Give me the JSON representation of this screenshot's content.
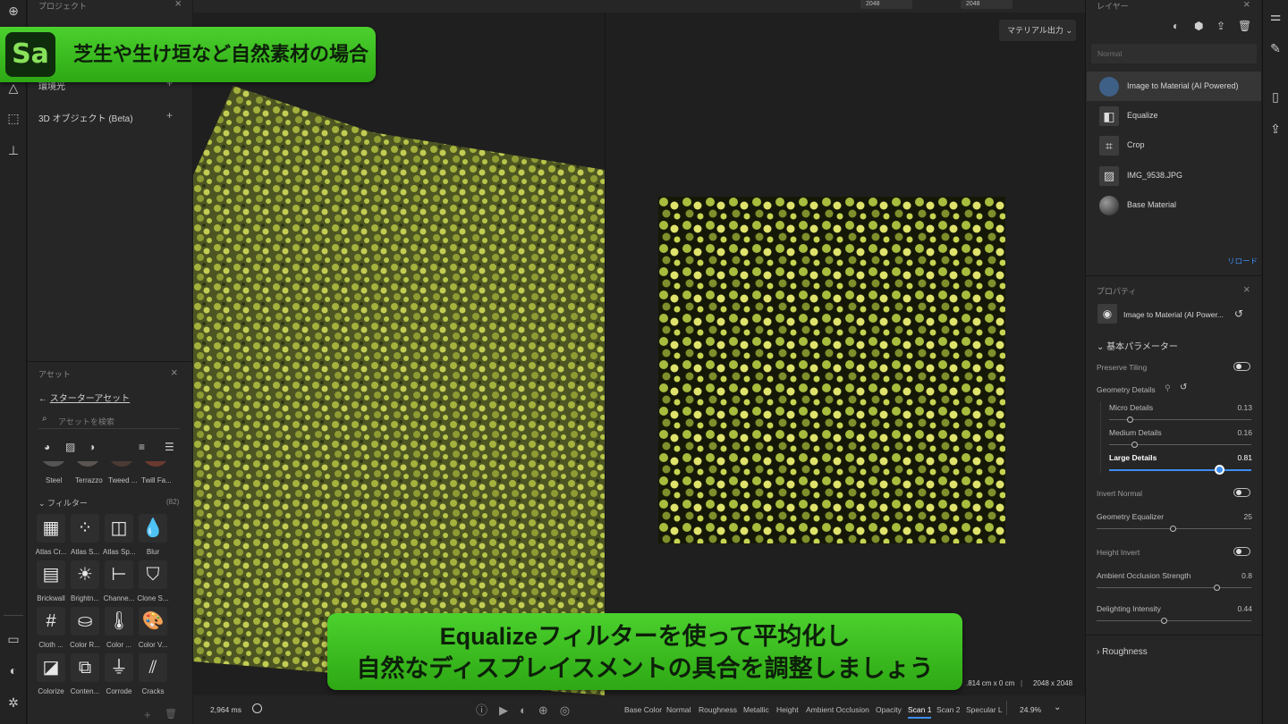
{
  "banner": {
    "logo": "Sa",
    "text": "芝生や生け垣など自然素材の場合"
  },
  "caption": {
    "line1": "Equalizeフィルターを使って平均化し",
    "line2": "自然なディスプレイスメントの具合を調整しましょう"
  },
  "project_panel": {
    "title": "プロジェクト",
    "items": [
      {
        "label": "環境光"
      },
      {
        "label": "3D オブジェクト (Beta)"
      }
    ]
  },
  "assets_panel": {
    "title": "アセット",
    "back_label": "スターターアセット",
    "search_placeholder": "アセットを検索",
    "materials": [
      "Steel",
      "Terrazzo",
      "Tweed ...",
      "Twill Fa..."
    ],
    "filters_title": "フィルター",
    "filters_count": "(82)",
    "filters": [
      {
        "label": "Atlas Cr...",
        "icon": "checker-icon",
        "glyph": "▦"
      },
      {
        "label": "Atlas S...",
        "icon": "scatter-icon",
        "glyph": "⁘"
      },
      {
        "label": "Atlas Sp...",
        "icon": "atlas-split-icon",
        "glyph": "◫"
      },
      {
        "label": "Blur",
        "icon": "drop-icon",
        "glyph": "💧"
      },
      {
        "label": "Brickwall",
        "icon": "brick-icon",
        "glyph": "▤"
      },
      {
        "label": "Brightn...",
        "icon": "sun-icon",
        "glyph": "☀"
      },
      {
        "label": "Channe...",
        "icon": "channel-icon",
        "glyph": "⊢"
      },
      {
        "label": "Clone S...",
        "icon": "stamp-icon",
        "glyph": "⛉"
      },
      {
        "label": "Cloth ...",
        "icon": "cloth-icon",
        "glyph": "#"
      },
      {
        "label": "Color R...",
        "icon": "color-replace-icon",
        "glyph": "⛀"
      },
      {
        "label": "Color ...",
        "icon": "thermometer-icon",
        "glyph": "🌡"
      },
      {
        "label": "Color V...",
        "icon": "palette-icon",
        "glyph": "🎨"
      },
      {
        "label": "Colorize",
        "icon": "bucket-icon",
        "glyph": "◪"
      },
      {
        "label": "Conten...",
        "icon": "content-icon",
        "glyph": "⧉"
      },
      {
        "label": "Corrode",
        "icon": "corrode-icon",
        "glyph": "⏚"
      },
      {
        "label": "Cracks",
        "icon": "cracks-icon",
        "glyph": "⫽"
      }
    ]
  },
  "viewport": {
    "export_button": "マテリアル出力",
    "top_size_a": "2048",
    "top_size_b": "2048",
    "render_time": "2,964 ms",
    "dimensions_text": ".814 cm x 0 cm",
    "resolution": "2048 x 2048",
    "zoom": "24.9%",
    "channel_tabs": [
      "Base Color",
      "Normal",
      "Roughness",
      "Metallic",
      "Height",
      "Ambient Occlusion",
      "Opacity",
      "Scan 1",
      "Scan 2",
      "Specular L"
    ],
    "active_tab": "Scan 1"
  },
  "layers_panel": {
    "title": "レイヤー",
    "blend_mode": "Normal",
    "items": [
      {
        "label": "Image to Material (AI Powered)"
      },
      {
        "label": "Equalize"
      },
      {
        "label": "Crop"
      },
      {
        "label": "IMG_9538.JPG"
      },
      {
        "label": "Base Material"
      }
    ],
    "reload": "リロード"
  },
  "properties_panel": {
    "title": "プロパティ",
    "node_name": "Image to Material (AI Power...",
    "section": "基本パラメーター",
    "preserve_tiling": "Preserve Tiling",
    "geometry_details": "Geometry Details",
    "micro_details": {
      "label": "Micro Details",
      "value": "0.13"
    },
    "medium_details": {
      "label": "Medium Details",
      "value": "0.16"
    },
    "large_details": {
      "label": "Large Details",
      "value": "0.81"
    },
    "invert_normal": "Invert Normal",
    "geometry_equalizer": {
      "label": "Geometry Equalizer",
      "value": "25"
    },
    "height_invert": "Height Invert",
    "ao_strength": {
      "label": "Ambient Occlusion Strength",
      "value": "0.8"
    },
    "delighting": {
      "label": "Delighting Intensity",
      "value": "0.44"
    },
    "roughness_section": "Roughness"
  },
  "colors": {
    "accent": "#3d8ef0",
    "banner_green": "#3cc221"
  }
}
